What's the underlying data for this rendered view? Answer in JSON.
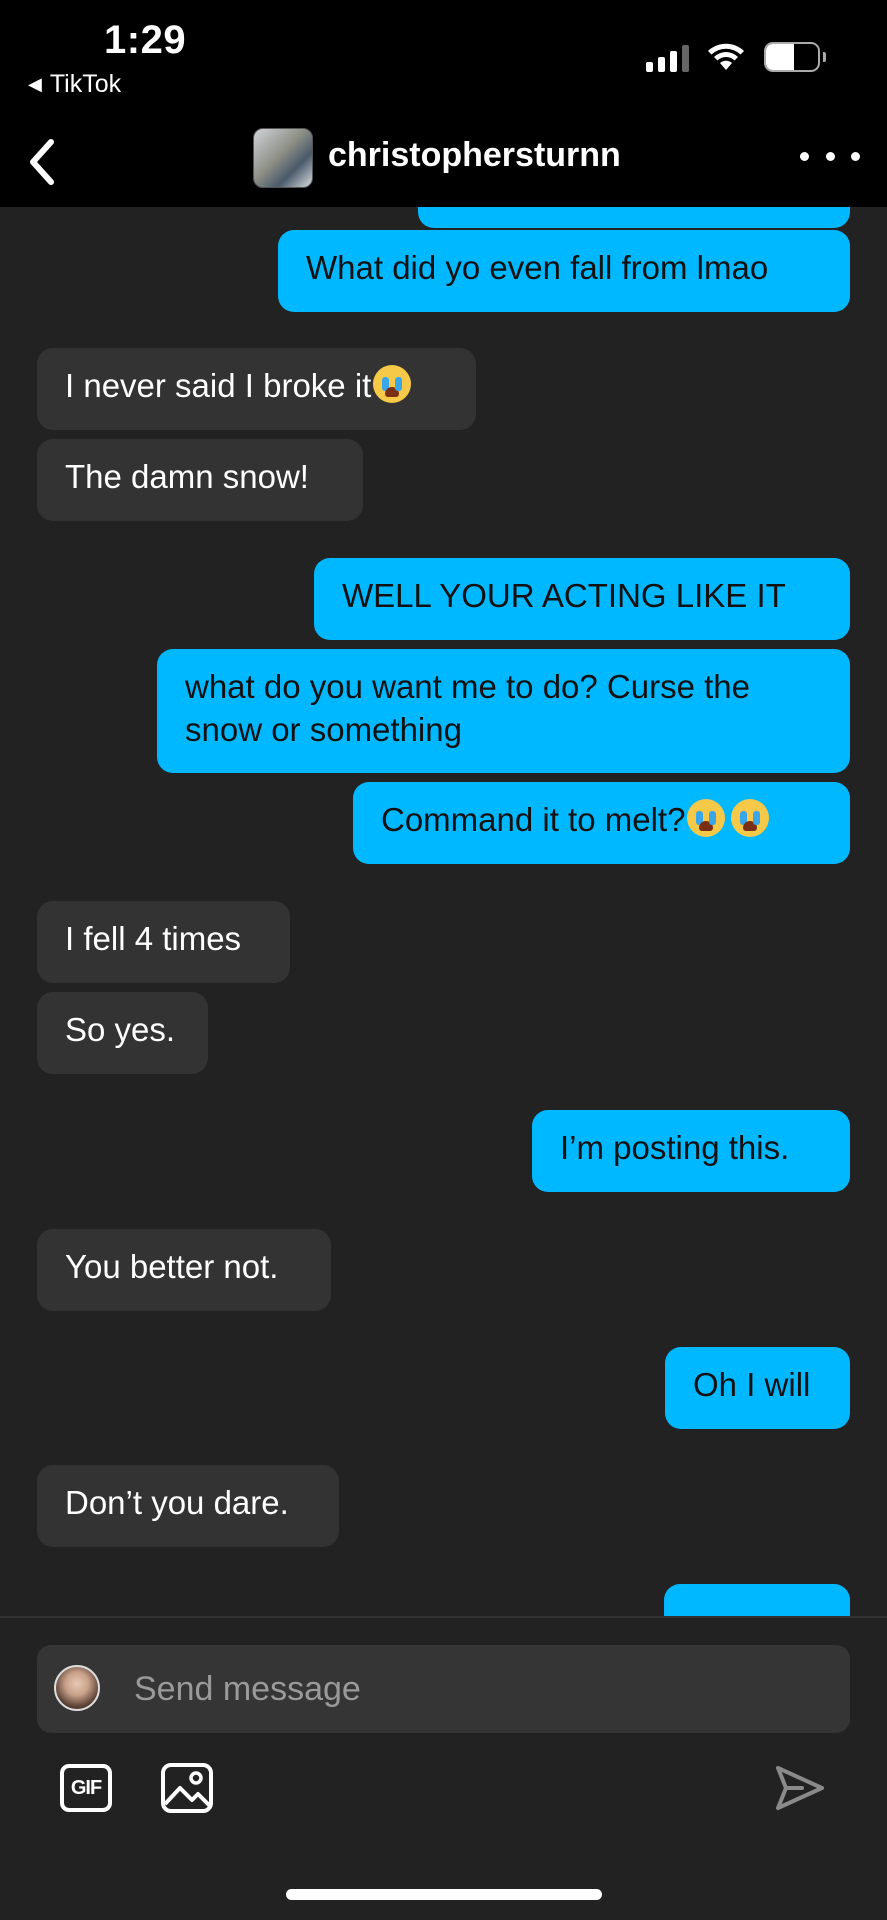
{
  "status_bar": {
    "time": "1:29",
    "back_app_label": "TikTok",
    "battery_percent": "53",
    "battery_level": 0.53
  },
  "header": {
    "username": "christophersturnn"
  },
  "colors": {
    "sent_bubble": "#00b8ff",
    "received_bubble": "#333333",
    "background": "#222222",
    "header": "#000000"
  },
  "messages": [
    {
      "from": "me",
      "text": ""
    },
    {
      "from": "me",
      "text": "What did yo even fall from lmao"
    },
    {
      "from": "them",
      "text": "I never said I broke it",
      "emoji": "loudly-crying-face"
    },
    {
      "from": "them",
      "text": "The damn snow!"
    },
    {
      "from": "me",
      "text": "WELL YOUR ACTING LIKE IT"
    },
    {
      "from": "me",
      "text": "what do you want me to do? Curse the snow or something"
    },
    {
      "from": "me",
      "text": "Command it to melt?",
      "emoji": "loudly-crying-face x2"
    },
    {
      "from": "them",
      "text": "I fell 4 times"
    },
    {
      "from": "them",
      "text": "So yes."
    },
    {
      "from": "me",
      "text": "I’m posting this."
    },
    {
      "from": "them",
      "text": "You better not."
    },
    {
      "from": "me",
      "text": "Oh I will"
    },
    {
      "from": "them",
      "text": "Don’t you dare."
    },
    {
      "from": "me",
      "text": ""
    }
  ],
  "composer": {
    "placeholder": "Send message",
    "gif_label": "GIF"
  },
  "icons": {
    "back": "chevron-left-icon",
    "more": "more-horizontal-icon",
    "image": "image-icon",
    "send": "send-icon"
  }
}
